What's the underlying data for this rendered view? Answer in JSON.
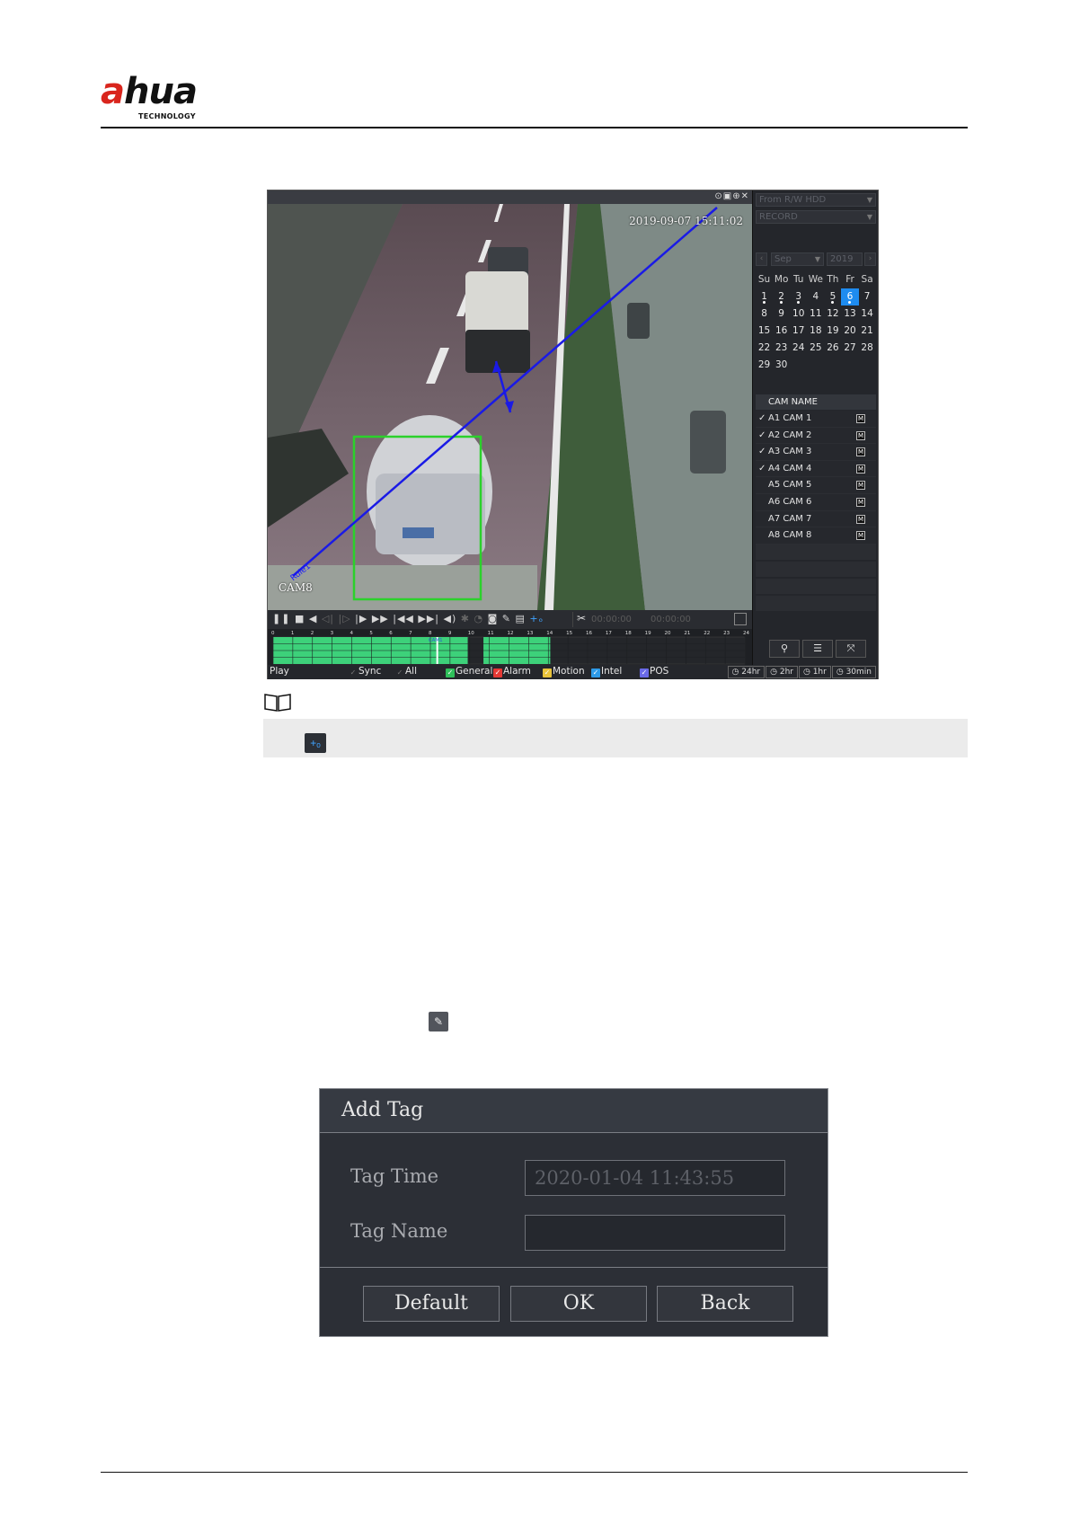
{
  "header": {
    "logo_text_red": "a",
    "logo_text_main": "hua",
    "logo_subtitle": "TECHNOLOGY"
  },
  "playback": {
    "source_dropdown": "From R/W HDD",
    "type_dropdown": "RECORD",
    "osd_time": "2019-09-07 15:11:02",
    "osd_camera": "CAM8",
    "osd_rule": "Rule1",
    "clip_start": "00:00:00",
    "clip_end": "00:00:00",
    "calendar": {
      "month": "Sep",
      "year": "2019",
      "weekdays": [
        "Su",
        "Mo",
        "Tu",
        "We",
        "Th",
        "Fr",
        "Sa"
      ],
      "weeks": [
        [
          "1",
          "2",
          "3",
          "4",
          "5",
          "6",
          "7"
        ],
        [
          "8",
          "9",
          "10",
          "11",
          "12",
          "13",
          "14"
        ],
        [
          "15",
          "16",
          "17",
          "18",
          "19",
          "20",
          "21"
        ],
        [
          "22",
          "23",
          "24",
          "25",
          "26",
          "27",
          "28"
        ],
        [
          "29",
          "30",
          "",
          "",
          "",
          "",
          ""
        ]
      ],
      "selected_day": "6",
      "days_with_records": [
        "1",
        "2",
        "3",
        "5",
        "6"
      ]
    },
    "camera_header": "CAM NAME",
    "cameras": [
      {
        "check": "✓",
        "name": "A1 CAM 1",
        "badge": "M"
      },
      {
        "check": "✓",
        "name": "A2 CAM 2",
        "badge": "M"
      },
      {
        "check": "✓",
        "name": "A3 CAM 3",
        "badge": "M"
      },
      {
        "check": "✓",
        "name": "A4 CAM 4",
        "badge": "M"
      },
      {
        "check": "",
        "name": "A5 CAM 5",
        "badge": "M"
      },
      {
        "check": "",
        "name": "A6 CAM 6",
        "badge": "M"
      },
      {
        "check": "",
        "name": "A7 CAM 7",
        "badge": "M"
      },
      {
        "check": "",
        "name": "A8 CAM 8",
        "badge": "M"
      }
    ],
    "timeline_hours": [
      "0",
      "1",
      "2",
      "3",
      "4",
      "5",
      "6",
      "7",
      "8",
      "9",
      "10",
      "11",
      "12",
      "13",
      "14",
      "15",
      "16",
      "17",
      "18",
      "19",
      "20",
      "21",
      "22",
      "23",
      "24"
    ],
    "timeline_label": "CAM1",
    "status": {
      "mode": "Play",
      "sync": "Sync",
      "all": "All",
      "general": "General",
      "alarm": "Alarm",
      "motion": "Motion",
      "intel": "Intel",
      "pos": "POS",
      "ranges": [
        "24hr",
        "2hr",
        "1hr",
        "30min"
      ]
    },
    "colors": {
      "general": "#2fbf5a",
      "alarm": "#e53935",
      "motion": "#e8c23a",
      "intel": "#2e9be8",
      "pos": "#6a6ae8",
      "record_bar": "#3dd17a",
      "today": "#1e8cf0"
    }
  },
  "dialog": {
    "title": "Add Tag",
    "tag_time_label": "Tag Time",
    "tag_time_value": "2020-01-04 11:43:55",
    "tag_name_label": "Tag Name",
    "tag_name_value": "",
    "default_label": "Default",
    "ok_label": "OK",
    "back_label": "Back"
  }
}
